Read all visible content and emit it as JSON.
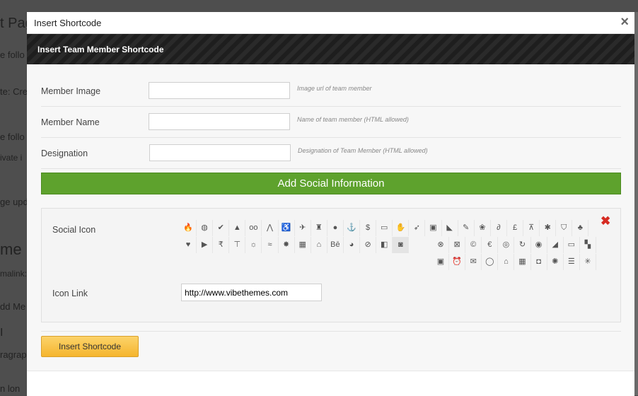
{
  "background": {
    "fragments": [
      {
        "text": "t Pag",
        "size": 20
      },
      {
        "text": "e follo",
        "size": 13
      },
      {
        "text": "te: Cre",
        "size": 13
      },
      {
        "text": "e follo",
        "size": 13
      },
      {
        "text": "ivate i",
        "size": 12
      },
      {
        "text": "ge upda",
        "size": 13
      },
      {
        "text": "me p",
        "size": 22
      },
      {
        "text": "malink:",
        "size": 12
      },
      {
        "text": "dd Me",
        "size": 13
      },
      {
        "text": "I",
        "size": 16
      },
      {
        "text": "ragraph",
        "size": 13
      },
      {
        "text": "n lon",
        "size": 13
      }
    ]
  },
  "modal": {
    "title": "Insert Shortcode",
    "close_symbol": "×",
    "subtitle": "Insert Team Member Shortcode",
    "fields": [
      {
        "label": "Member Image",
        "value": "",
        "hint": "Image url of team member"
      },
      {
        "label": "Member Name",
        "value": "",
        "hint": "Name of team member (HTML allowed)"
      },
      {
        "label": "Designation",
        "value": "",
        "hint": "Designation of Team Member (HTML allowed)"
      }
    ],
    "add_social_label": "Add Social Information",
    "social": {
      "icon_label": "Social Icon",
      "link_label": "Icon Link",
      "link_value": "http://www.vibethemes.com",
      "delete_symbol": "✖",
      "icons_row1": [
        {
          "name": "fire-icon",
          "glyph": "🔥"
        },
        {
          "name": "globe-icon",
          "glyph": "◍"
        },
        {
          "name": "broom-icon",
          "glyph": "✔"
        },
        {
          "name": "drop-icon",
          "glyph": "▲"
        },
        {
          "name": "glasses-icon",
          "glyph": "oo"
        },
        {
          "name": "road-icon",
          "glyph": "⋀"
        },
        {
          "name": "wheelchair-icon",
          "glyph": "♿"
        },
        {
          "name": "plane-icon",
          "glyph": "✈"
        },
        {
          "name": "castle-icon",
          "glyph": "♜"
        },
        {
          "name": "ball-icon",
          "glyph": "●"
        },
        {
          "name": "anchor-icon",
          "glyph": "⚓"
        },
        {
          "name": "dollar-icon",
          "glyph": "$"
        },
        {
          "name": "money-icon",
          "glyph": "▭"
        },
        {
          "name": "hand-icon",
          "glyph": "✋"
        },
        {
          "name": "runner-icon",
          "glyph": "➶"
        },
        {
          "name": "bag-icon",
          "glyph": "▣"
        },
        {
          "name": "paint-bucket-icon",
          "glyph": "◣"
        },
        {
          "name": "pencil-icon",
          "glyph": "✎"
        },
        {
          "name": "paw-icon",
          "glyph": "❀"
        },
        {
          "name": "paperclip-icon",
          "glyph": "∂"
        },
        {
          "name": "pound-icon",
          "glyph": "£"
        },
        {
          "name": "cart-icon",
          "glyph": "⊼"
        },
        {
          "name": "splat-icon",
          "glyph": "✱"
        },
        {
          "name": "shield-icon",
          "glyph": "⛉"
        },
        {
          "name": "trees-icon",
          "glyph": "♣"
        }
      ],
      "icons_row2": [
        {
          "name": "lamp-icon",
          "glyph": "♥"
        },
        {
          "name": "youtube-icon",
          "glyph": "▶"
        },
        {
          "name": "rupee-icon",
          "glyph": "₹"
        },
        {
          "name": "signpost-icon",
          "glyph": "⊤"
        },
        {
          "name": "sun-icon",
          "glyph": "☼"
        },
        {
          "name": "waves-icon",
          "glyph": "≈"
        },
        {
          "name": "bug-icon",
          "glyph": "✸"
        },
        {
          "name": "briefcase-icon",
          "glyph": "▦"
        },
        {
          "name": "gamepad-icon",
          "glyph": "⌂"
        },
        {
          "name": "behance-icon",
          "glyph": "Bē"
        },
        {
          "name": "piechart-icon",
          "glyph": "◕"
        },
        {
          "name": "ban-icon",
          "glyph": "⊘"
        },
        {
          "name": "book-icon",
          "glyph": "◧"
        },
        {
          "name": "camera-icon",
          "glyph": "◙"
        }
      ],
      "icons_row2b": [
        {
          "name": "close-circle-icon",
          "glyph": "⊗"
        },
        {
          "name": "close-square-icon",
          "glyph": "⊠"
        },
        {
          "name": "creative-commons-icon",
          "glyph": "©"
        },
        {
          "name": "euro-circle-icon",
          "glyph": "€"
        },
        {
          "name": "coin-icon",
          "glyph": "◎"
        },
        {
          "name": "refresh-icon",
          "glyph": "↻"
        },
        {
          "name": "record-icon",
          "glyph": "◉"
        },
        {
          "name": "signal-icon",
          "glyph": "◢"
        },
        {
          "name": "desktop-icon",
          "glyph": "▭"
        },
        {
          "name": "checker-icon",
          "glyph": "▚"
        }
      ],
      "icons_row3": [
        {
          "name": "instagram-icon",
          "glyph": "▣"
        },
        {
          "name": "alarm-icon",
          "glyph": "⏰"
        },
        {
          "name": "envelope-icon",
          "glyph": "✉"
        },
        {
          "name": "chat-bubble-icon",
          "glyph": "◯"
        },
        {
          "name": "inbox-icon",
          "glyph": "⌂"
        },
        {
          "name": "calculator-icon",
          "glyph": "▦"
        },
        {
          "name": "camera-retro-icon",
          "glyph": "◘"
        },
        {
          "name": "brightness-icon",
          "glyph": "✺"
        },
        {
          "name": "list-box-icon",
          "glyph": "☰"
        },
        {
          "name": "spinner-icon",
          "glyph": "✳"
        }
      ]
    },
    "insert_label": "Insert Shortcode"
  }
}
